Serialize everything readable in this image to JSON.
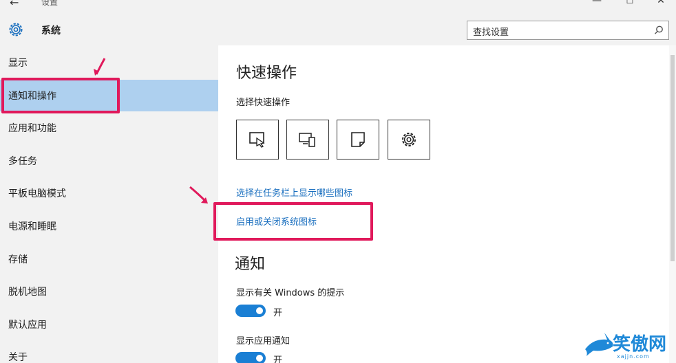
{
  "window": {
    "title": "设置",
    "back_icon": "back-arrow-icon",
    "minimize_icon": "minimize-icon",
    "maximize_icon": "maximize-icon",
    "close_icon": "close-icon"
  },
  "header": {
    "title": "系统",
    "icon": "gear-icon",
    "search": {
      "value": "查找设置",
      "icon": "search-icon"
    }
  },
  "sidebar": {
    "items": [
      {
        "label": "显示"
      },
      {
        "label": "通知和操作",
        "selected": true
      },
      {
        "label": "应用和功能"
      },
      {
        "label": "多任务"
      },
      {
        "label": "平板电脑模式"
      },
      {
        "label": "电源和睡眠"
      },
      {
        "label": "存储"
      },
      {
        "label": "脱机地图"
      },
      {
        "label": "默认应用"
      },
      {
        "label": "关于"
      }
    ]
  },
  "main": {
    "quick_actions_heading": "快速操作",
    "quick_actions_sub": "选择快速操作",
    "tiles": [
      {
        "icon": "tablet-mode-icon"
      },
      {
        "icon": "project-icon"
      },
      {
        "icon": "note-icon"
      },
      {
        "icon": "settings-icon"
      }
    ],
    "links": [
      "选择在任务栏上显示哪些图标",
      "启用或关闭系统图标"
    ],
    "notifications_heading": "通知",
    "settings": [
      {
        "label": "显示有关 Windows 的提示",
        "state": "开",
        "on": true
      },
      {
        "label": "显示应用通知",
        "state": "开",
        "on": true
      }
    ]
  },
  "annotations": {
    "highlight_color": "#e0195b"
  },
  "watermark": {
    "text": "笑傲网",
    "sub": "xajjn.com",
    "color": "#1f89d8"
  },
  "colors": {
    "accent": "#1a7fd4",
    "selected_bg": "#aed0ef",
    "link": "#1a6fbf"
  }
}
